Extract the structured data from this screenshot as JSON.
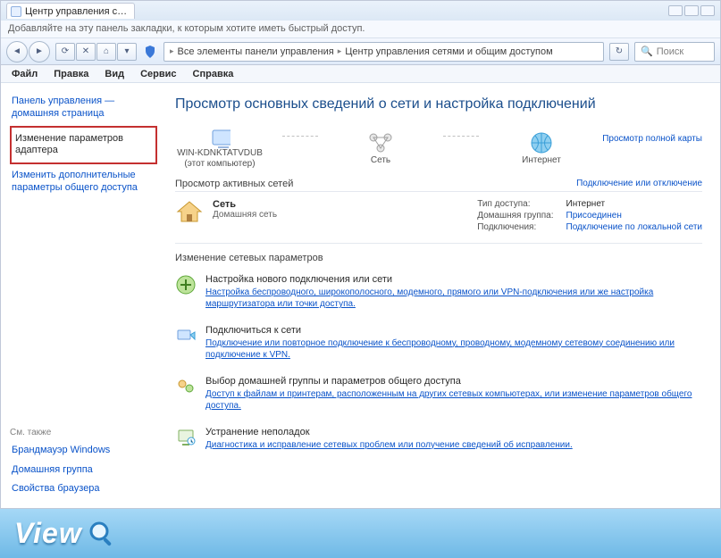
{
  "window": {
    "tab_title": "Центр управления с…"
  },
  "bookmark_hint": "Добавляйте на эту панель закладки, к которым хотите иметь быстрый доступ.",
  "breadcrumb": {
    "part1": "Все элементы панели управления",
    "part2": "Центр управления сетями и общим доступом"
  },
  "search": {
    "placeholder": "Поиск"
  },
  "menu": [
    "Файл",
    "Правка",
    "Вид",
    "Сервис",
    "Справка"
  ],
  "sidebar": {
    "home": "Панель управления — домашняя страница",
    "adapter": "Изменение параметров адаптера",
    "sharing": "Изменить дополнительные параметры общего доступа",
    "see_also": "См. также",
    "links": [
      "Брандмауэр Windows",
      "Домашняя группа",
      "Свойства браузера"
    ]
  },
  "main": {
    "heading": "Просмотр основных сведений о сети и настройка подключений",
    "map_link": "Просмотр полной карты",
    "nodes": {
      "pc": "WIN-KDNKTATVDUB",
      "pc_sub": "(этот компьютер)",
      "net": "Сеть",
      "inet": "Интернет"
    },
    "active_title": "Просмотр активных сетей",
    "active_link": "Подключение или отключение",
    "network": {
      "name": "Сеть",
      "type": "Домашняя сеть"
    },
    "details": {
      "k1": "Тип доступа:",
      "v1": "Интернет",
      "k2": "Домашняя группа:",
      "v2": "Присоединен",
      "k3": "Подключения:",
      "v3": "Подключение по локальной сети"
    },
    "change_title": "Изменение сетевых параметров",
    "tasks": [
      {
        "title": "Настройка нового подключения или сети",
        "desc": "Настройка беспроводного, широкополосного, модемного, прямого или VPN-подключения или же настройка маршрутизатора или точки доступа."
      },
      {
        "title": "Подключиться к сети",
        "desc": "Подключение или повторное подключение к беспроводному, проводному, модемному сетевому соединению или подключение к VPN."
      },
      {
        "title": "Выбор домашней группы и параметров общего доступа",
        "desc": "Доступ к файлам и принтерам, расположенным на других сетевых компьютерах, или изменение параметров общего доступа."
      },
      {
        "title": "Устранение неполадок",
        "desc": "Диагностика и исправление сетевых проблем или получение сведений об исправлении."
      }
    ]
  },
  "brand": "View"
}
